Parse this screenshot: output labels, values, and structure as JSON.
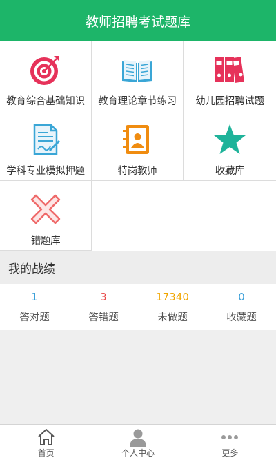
{
  "header": {
    "title": "教师招聘考试题库"
  },
  "categories": [
    {
      "label": "教育综合基础知识",
      "icon": "target-icon"
    },
    {
      "label": "教育理论章节练习",
      "icon": "open-book-icon"
    },
    {
      "label": "幼儿园招聘试题",
      "icon": "binders-icon"
    },
    {
      "label": "学科专业模拟押题",
      "icon": "document-pen-icon"
    },
    {
      "label": "特岗教师",
      "icon": "contact-book-icon"
    },
    {
      "label": "收藏库",
      "icon": "star-icon"
    },
    {
      "label": "错题库",
      "icon": "cross-icon"
    }
  ],
  "record": {
    "title": "我的战绩",
    "stats": [
      {
        "value": "1",
        "label": "答对题",
        "color": "#3a9fd8"
      },
      {
        "value": "3",
        "label": "答错题",
        "color": "#e84a4a"
      },
      {
        "value": "17340",
        "label": "未做题",
        "color": "#f0a500"
      },
      {
        "value": "0",
        "label": "收藏题",
        "color": "#3a9fd8"
      }
    ]
  },
  "tabbar": {
    "items": [
      {
        "label": "首页",
        "icon": "home-icon"
      },
      {
        "label": "个人中心",
        "icon": "user-icon"
      },
      {
        "label": "更多",
        "icon": "more-icon"
      }
    ]
  },
  "colors": {
    "brand": "#1db569"
  }
}
